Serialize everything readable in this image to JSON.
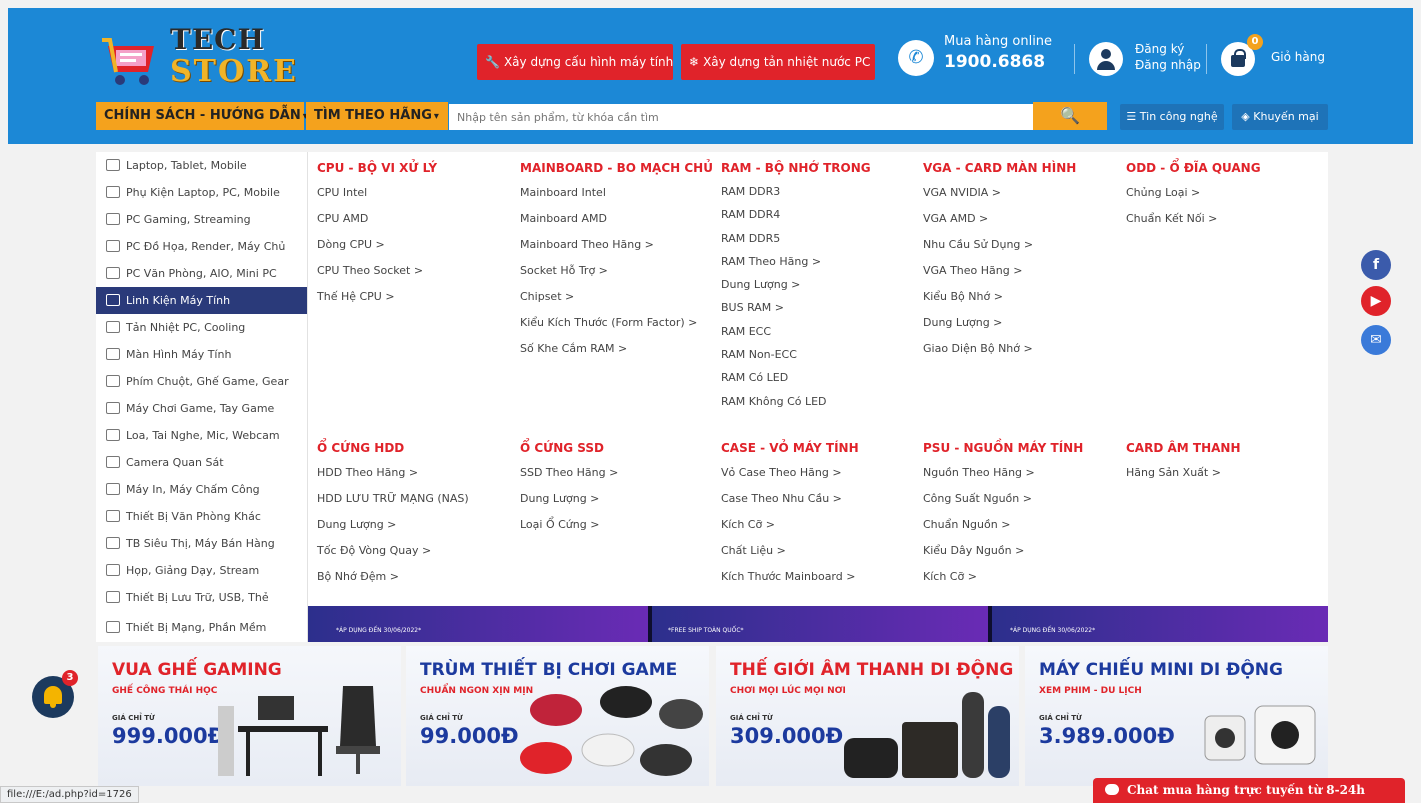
{
  "logo": {
    "line1": "TECH",
    "line2": "STORE"
  },
  "header_buttons": {
    "build_pc": "Xây dựng cấu hình máy tính",
    "water_cooling": "Xây dựng tản nhiệt nước PC"
  },
  "hotline": {
    "label": "Mua hàng online",
    "number": "1900.6868"
  },
  "account": {
    "register": "Đăng ký",
    "login": "Đăng nhập"
  },
  "cart": {
    "label": "Giỏ hàng",
    "count": "0"
  },
  "nav": {
    "policy": "CHÍNH SÁCH - HƯỚNG DẪN",
    "brand": "TÌM THEO HÃNG",
    "search_placeholder": "Nhập tên sản phẩm, từ khóa cần tìm",
    "tech_news": "Tin công nghệ",
    "promotion": "Khuyến mại"
  },
  "sidebar": [
    "Laptop, Tablet, Mobile",
    "Phụ Kiện Laptop, PC, Mobile",
    "PC Gaming, Streaming",
    "PC Đồ Họa, Render, Máy Chủ",
    "PC Văn Phòng, AIO, Mini PC",
    "Linh Kiện Máy Tính",
    "Tản Nhiệt PC, Cooling",
    "Màn Hình Máy Tính",
    "Phím Chuột, Ghế Game, Gear",
    "Máy Chơi Game, Tay Game",
    "Loa, Tai Nghe, Mic, Webcam",
    "Camera Quan Sát",
    "Máy In, Máy Chấm Công",
    "Thiết Bị Văn Phòng Khác",
    "TB Siêu Thị, Máy Bán Hàng",
    "Họp, Giảng Dạy, Stream",
    "Thiết Bị Lưu Trữ, USB, Thẻ",
    "Thiết Bị Mạng, Phần Mềm"
  ],
  "mega_menu": {
    "row1": [
      {
        "title": "CPU - BỘ VI XỬ LÝ",
        "items": [
          "CPU Intel",
          "CPU AMD",
          "Dòng CPU >",
          "CPU Theo Socket >",
          "Thế Hệ CPU >"
        ]
      },
      {
        "title": "MAINBOARD - BO MẠCH CHỦ",
        "items": [
          "Mainboard Intel",
          "Mainboard AMD",
          "Mainboard Theo Hãng >",
          "Socket Hỗ Trợ >",
          "Chipset >",
          "Kiểu Kích Thước (Form Factor) >",
          "Số Khe Cắm RAM >"
        ]
      },
      {
        "title": "RAM - BỘ NHỚ TRONG",
        "items": [
          "RAM DDR3",
          "RAM DDR4",
          "RAM DDR5",
          "RAM Theo Hãng >",
          "Dung Lượng >",
          "BUS RAM >",
          "RAM ECC",
          "RAM Non-ECC",
          "RAM Có LED",
          "RAM Không Có LED"
        ]
      },
      {
        "title": "VGA - CARD MÀN HÌNH",
        "items": [
          "VGA NVIDIA >",
          "VGA AMD >",
          "Nhu Cầu Sử Dụng >",
          "VGA Theo Hãng >",
          "Kiểu Bộ Nhớ >",
          "Dung Lượng >",
          "Giao Diện Bộ Nhớ >"
        ]
      },
      {
        "title": "ODD - Ổ ĐĨA QUANG",
        "items": [
          "Chủng Loại >",
          "Chuẩn Kết Nối >"
        ]
      }
    ],
    "row2": [
      {
        "title": "Ổ CỨNG HDD",
        "items": [
          "HDD Theo Hãng >",
          "HDD LƯU TRỮ MẠNG (NAS)",
          "Dung Lượng >",
          "Tốc Độ Vòng Quay >",
          "Bộ Nhớ Đệm >"
        ]
      },
      {
        "title": "Ổ CỨNG SSD",
        "items": [
          "SSD Theo Hãng >",
          "Dung Lượng >",
          "Loại Ổ Cứng >"
        ]
      },
      {
        "title": "CASE - VỎ MÁY TÍNH",
        "items": [
          "Vỏ Case Theo Hãng >",
          "Case Theo Nhu Cầu >",
          "Kích Cỡ >",
          "Chất Liệu >",
          "Kích Thước Mainboard >"
        ]
      },
      {
        "title": "PSU - NGUỒN MÁY TÍNH",
        "items": [
          "Nguồn Theo Hãng >",
          "Công Suất Nguồn >",
          "Chuẩn Nguồn >",
          "Kiểu Dây Nguồn >",
          "Kích Cỡ >"
        ]
      },
      {
        "title": "CARD ÂM THANH",
        "items": [
          "Hãng Sản Xuất >"
        ]
      }
    ]
  },
  "banner_strip": {
    "note1": "*ÁP DỤNG ĐẾN 30/06/2022*",
    "note2": "*FREE SHIP TOÀN QUỐC*",
    "note3": "*ÁP DỤNG ĐẾN 30/06/2022*"
  },
  "promos": [
    {
      "title": "VUA GHẾ GAMING",
      "subtitle": "GHẾ CÔNG THÁI HỌC",
      "from": "GIÁ CHỈ TỪ",
      "price": "999.000Đ",
      "title_color": "#e0232a"
    },
    {
      "title": "TRÙM THIẾT BỊ CHƠI GAME",
      "subtitle": "CHUẨN NGON XỊN MỊN",
      "from": "GIÁ CHỈ TỪ",
      "price": "99.000Đ",
      "title_color": "#1c3a9e"
    },
    {
      "title": "THẾ GIỚI ÂM THANH DI ĐỘNG",
      "subtitle": "CHƠI MỌI LÚC MỌI NƠI",
      "from": "GIÁ CHỈ TỪ",
      "price": "309.000Đ",
      "title_color": "#e0232a"
    },
    {
      "title": "MÁY CHIẾU MINI DI ĐỘNG",
      "subtitle": "XEM PHIM - DU LỊCH",
      "from": "GIÁ CHỈ TỪ",
      "price": "3.989.000Đ",
      "title_color": "#1c3a9e"
    }
  ],
  "notification": {
    "count": "3"
  },
  "status_bar": {
    "url": "file:///E:/ad.php?id=1726"
  },
  "chat": {
    "label": "Chat mua hàng trực tuyến từ 8-24h"
  },
  "colors": {
    "header_blue": "#1c88d6",
    "accent_orange": "#f4a21d",
    "accent_red": "#e0232a",
    "navy": "#2a3a7a"
  }
}
